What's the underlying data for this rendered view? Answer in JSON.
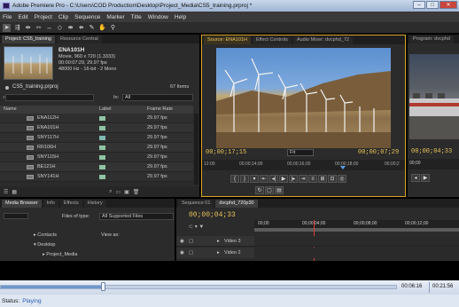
{
  "window": {
    "title": "Adobe Premiere Pro - C:\\Users\\COD Production\\Desktop\\Project_Media\\CS5_training.prproj *",
    "minimize": "–",
    "maximize": "□",
    "close": "✕"
  },
  "menu": [
    "File",
    "Edit",
    "Project",
    "Clip",
    "Sequence",
    "Marker",
    "Title",
    "Window",
    "Help"
  ],
  "tools": [
    "selection-tool",
    "track-select-tool",
    "ripple-edit-tool",
    "rolling-edit-tool",
    "rate-stretch-tool",
    "razor-tool",
    "slip-tool",
    "slide-tool",
    "pen-tool",
    "hand-tool",
    "zoom-tool"
  ],
  "project_panel": {
    "tabs": [
      "Project: CS5_training",
      "Resource Central"
    ],
    "clip": {
      "name": "ENA101H",
      "info1": "Movie, 960 x 720 (1.3333)",
      "info2": "00:00:07:29, 29.97 fps",
      "info3": "48000 Hz - 16-bit - 2 Mono"
    },
    "project_file": "CS5_training.prproj",
    "item_count": "67 Items",
    "in_label": "In:",
    "in_value": "All",
    "columns": [
      "Name",
      "Label",
      "Frame Rate"
    ],
    "rows": [
      {
        "name": "ENA112H",
        "rate": "29.97 fps"
      },
      {
        "name": "ENA101H",
        "rate": "29.97 fps"
      },
      {
        "name": "SNY117H",
        "rate": "29.97 fps"
      },
      {
        "name": "RR106H",
        "rate": "29.97 fps"
      },
      {
        "name": "SNY115H",
        "rate": "29.97 fps"
      },
      {
        "name": "BE121H",
        "rate": "29.97 fps"
      },
      {
        "name": "SNY141H",
        "rate": "29.97 fps"
      }
    ]
  },
  "source_monitor": {
    "tabs": [
      "Source: ENA101H",
      "Effect Controls",
      "Audio Mixer: dvcphd_72"
    ],
    "current_tc": "00;00;17;15",
    "fit": "Fit",
    "duration_tc": "00;00;07;29",
    "ruler": [
      "12:00",
      "00;00;14;00",
      "00;00;16;00",
      "00;00;18;00",
      "00;00;2"
    ]
  },
  "program_monitor": {
    "tabs": [
      "Program: dvcphd"
    ],
    "current_tc": "00;00;04;33",
    "ruler": [
      "00;00"
    ]
  },
  "media_browser": {
    "tabs": [
      "Media Browser",
      "Info",
      "Effects",
      "History"
    ],
    "files_of_type_label": "Files of type:",
    "files_of_type_value": "All Supported Files",
    "view_as": "View as:",
    "tree": [
      "Contacts",
      "Desktop",
      "Project_Media"
    ]
  },
  "timeline": {
    "tabs": [
      "Sequence 01",
      "dvcphd_720p30"
    ],
    "current_tc": "00;00;04;33",
    "ruler": [
      "00;00",
      "00;00;04;00",
      "00;00;08;00",
      "00;00;12;00"
    ],
    "tracks": [
      "Video 3",
      "Video 2"
    ]
  },
  "player": {
    "elapsed": "00:06:16",
    "total": "00:21:56",
    "progress": 0.26
  },
  "status": {
    "label": "Status:",
    "value": "Playing"
  },
  "colors": {
    "label_mint": "#8fc4a5",
    "label_teal": "#7fb8b0",
    "timecode": "#e8c15a",
    "panel_focus": "#d9a528"
  }
}
